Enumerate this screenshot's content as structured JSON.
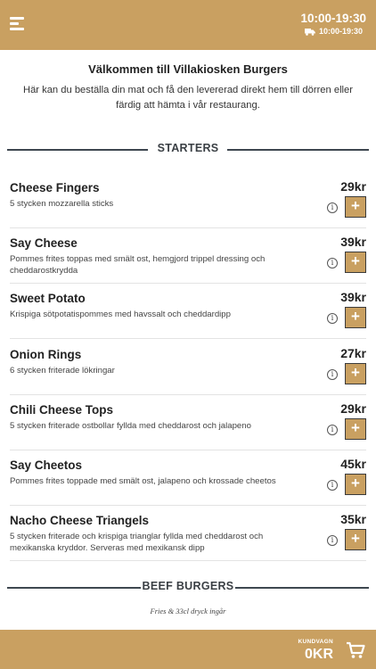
{
  "header": {
    "menu_icon": "hamburger-icon",
    "hours": "10:00-19:30",
    "delivery_hours": "10:00-19:30",
    "delivery_icon": "truck-icon",
    "brand_color": "#c9a061"
  },
  "welcome": {
    "title": "Välkommen till Villakiosken Burgers",
    "text": "Här kan du beställa din mat och få den levererad direkt hem till dörren eller färdig att hämta i vår restaurang."
  },
  "sections": {
    "starters": {
      "title": "STARTERS",
      "items": [
        {
          "name": "Cheese Fingers",
          "desc": "5 stycken mozzarella sticks",
          "price": "29kr"
        },
        {
          "name": "Say Cheese",
          "desc": "Pommes frites toppas med smält ost, hemgjord trippel dressing och cheddarostkrydda",
          "price": "39kr"
        },
        {
          "name": "Sweet Potato",
          "desc": "Krispiga sötpotatispommes med havssalt och cheddardipp",
          "price": "39kr"
        },
        {
          "name": "Onion Rings",
          "desc": "6 stycken friterade lökringar",
          "price": "27kr"
        },
        {
          "name": "Chili Cheese Tops",
          "desc": "5 stycken friterade ostbollar fyllda med cheddarost och jalapeno",
          "price": "29kr"
        },
        {
          "name": "Say Cheetos",
          "desc": "Pommes frites toppade med smält ost, jalapeno och krossade cheetos",
          "price": "45kr"
        },
        {
          "name": "Nacho Cheese Triangels",
          "desc": "5 stycken friterade och krispiga trianglar fyllda med cheddarost och mexikanska kryddor. Serveras med mexikansk dipp",
          "price": "35kr"
        }
      ],
      "add_label": "+",
      "info_label": "i"
    },
    "beef": {
      "title": "BEEF BURGERS",
      "note": "Fries & 33cl dryck ingår"
    }
  },
  "cart": {
    "label": "KUNDVAGN",
    "total": "0KR",
    "icon": "shopping-cart-icon"
  }
}
